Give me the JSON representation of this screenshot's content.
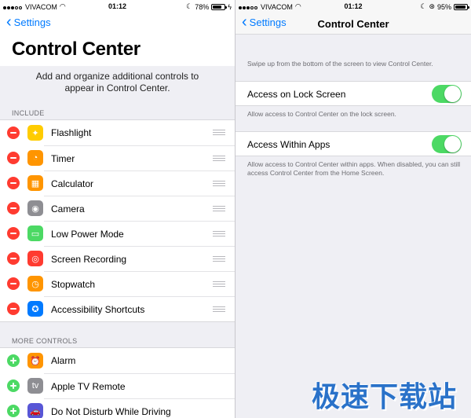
{
  "left": {
    "status": {
      "carrier": "VIVACOM",
      "time": "01:12",
      "battery": "78%"
    },
    "back_label": "Settings",
    "title": "Control Center",
    "description": "Add and organize additional controls to appear in Control Center.",
    "include_header": "INCLUDE",
    "include_items": [
      {
        "label": "Flashlight",
        "icon": "flashlight-icon",
        "color": "#ffcc00",
        "glyph": "✦"
      },
      {
        "label": "Timer",
        "icon": "timer-icon",
        "color": "#ff9500",
        "glyph": "◔"
      },
      {
        "label": "Calculator",
        "icon": "calculator-icon",
        "color": "#ff9500",
        "glyph": "▦"
      },
      {
        "label": "Camera",
        "icon": "camera-icon",
        "color": "#8e8e93",
        "glyph": "◉"
      },
      {
        "label": "Low Power Mode",
        "icon": "battery-icon",
        "color": "#4cd964",
        "glyph": "▭"
      },
      {
        "label": "Screen Recording",
        "icon": "record-icon",
        "color": "#ff3b30",
        "glyph": "◎"
      },
      {
        "label": "Stopwatch",
        "icon": "stopwatch-icon",
        "color": "#ff9500",
        "glyph": "◷"
      },
      {
        "label": "Accessibility Shortcuts",
        "icon": "accessibility-icon",
        "color": "#007aff",
        "glyph": "✪"
      }
    ],
    "more_header": "MORE CONTROLS",
    "more_items": [
      {
        "label": "Alarm",
        "icon": "alarm-icon",
        "color": "#ff9500",
        "glyph": "⏰"
      },
      {
        "label": "Apple TV Remote",
        "icon": "apple-tv-icon",
        "color": "#8e8e93",
        "glyph": "tv"
      },
      {
        "label": "Do Not Disturb While Driving",
        "icon": "car-icon",
        "color": "#5856d6",
        "glyph": "🚗"
      }
    ]
  },
  "right": {
    "status": {
      "carrier": "VIVACOM",
      "time": "01:12",
      "battery": "95%"
    },
    "back_label": "Settings",
    "nav_title": "Control Center",
    "intro": "Swipe up from the bottom of the screen to view Control Center.",
    "lock_screen": {
      "label": "Access on Lock Screen",
      "on": true,
      "note": "Allow access to Control Center on the lock screen."
    },
    "within_apps": {
      "label": "Access Within Apps",
      "on": true,
      "note": "Allow access to Control Center within apps. When disabled, you can still access Control Center from the Home Screen."
    }
  },
  "watermark": "极速下载站",
  "colors": {
    "accent": "#007aff",
    "toggle_on": "#4cd964",
    "remove": "#ff3b30"
  }
}
